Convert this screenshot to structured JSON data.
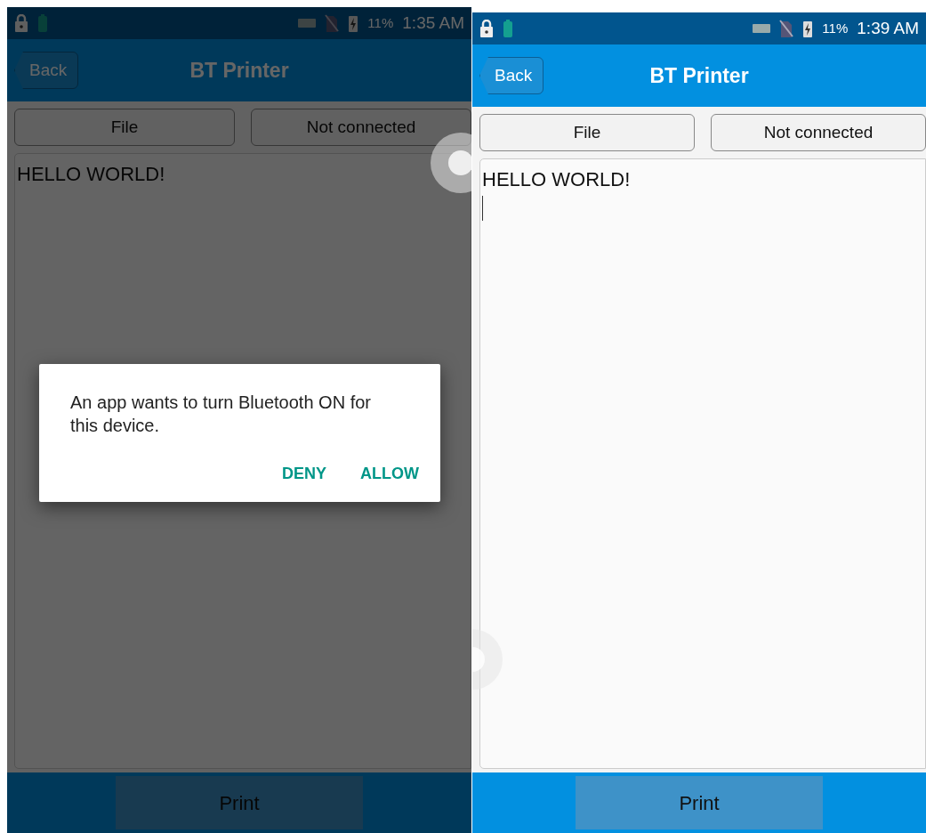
{
  "screens": [
    {
      "dimmed": true,
      "status_bar": {
        "battery": "11%",
        "time": "1:35 AM"
      },
      "header": {
        "back": "Back",
        "title": "BT Printer"
      },
      "buttons": [
        "File",
        "Not connected"
      ],
      "editor": {
        "text": "HELLO WORLD!",
        "cursor": false
      },
      "print": "Print",
      "dialog": {
        "message": "An app wants to turn Bluetooth ON for this device.",
        "actions": [
          "DENY",
          "ALLOW"
        ]
      }
    },
    {
      "dimmed": false,
      "status_bar": {
        "battery": "11%",
        "time": "1:39 AM"
      },
      "header": {
        "back": "Back",
        "title": "BT Printer"
      },
      "buttons": [
        "File",
        "Not connected"
      ],
      "editor": {
        "text": "HELLO WORLD!",
        "cursor": true
      },
      "print": "Print"
    }
  ]
}
